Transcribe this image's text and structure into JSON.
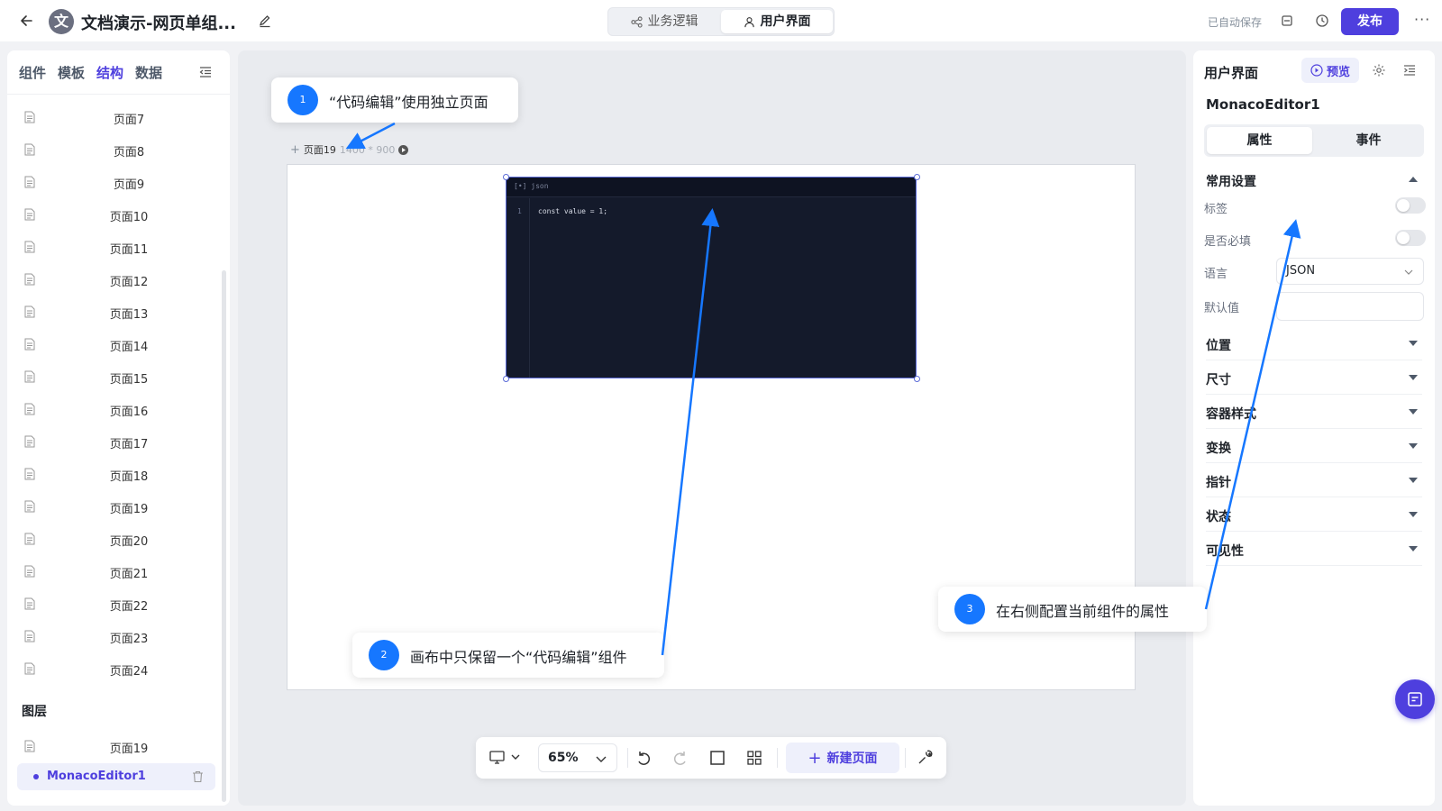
{
  "header": {
    "back_icon": "arrow-left-icon",
    "avatar_char": "文",
    "title": "文档演示-网页单组...",
    "mode_tabs": [
      {
        "label": "业务逻辑",
        "icon": "share-nodes-icon",
        "active": false
      },
      {
        "label": "用户界面",
        "icon": "user-icon",
        "active": true
      }
    ],
    "autosave": "已自动保存",
    "publish_label": "发布",
    "more_label": "···",
    "accent_color": "#4e3fde"
  },
  "left_panel": {
    "tabs": [
      {
        "label": "组件",
        "active": false
      },
      {
        "label": "模板",
        "active": false
      },
      {
        "label": "结构",
        "active": true
      },
      {
        "label": "数据",
        "active": false
      }
    ],
    "pages": [
      "页面7",
      "页面8",
      "页面9",
      "页面10",
      "页面11",
      "页面12",
      "页面13",
      "页面14",
      "页面15",
      "页面16",
      "页面17",
      "页面18",
      "页面19",
      "页面20",
      "页面21",
      "页面22",
      "页面23",
      "页面24"
    ],
    "layers_title": "图层",
    "layer_page": "页面19",
    "layer_item": "MonacoEditor1"
  },
  "canvas": {
    "page_name": "页面19",
    "page_dims": "1400 * 900",
    "editor": {
      "lang": "json",
      "line_number": "1",
      "code": "const value = 1;"
    }
  },
  "toolbar": {
    "zoom": "65%",
    "new_page_label": "新建页面"
  },
  "right_panel": {
    "title": "用户界面",
    "preview_label": "预览",
    "component_name": "MonacoEditor1",
    "seg_tabs": [
      "属性",
      "事件"
    ],
    "common_section": "常用设置",
    "fields": {
      "label": "标签",
      "required": "是否必填",
      "language": "语言",
      "language_value": "JSON",
      "default_value": "默认值"
    },
    "sections": [
      "位置",
      "尺寸",
      "容器样式",
      "变换",
      "指针",
      "状态",
      "可见性"
    ]
  },
  "callouts": [
    {
      "num": "1",
      "text": "“代码编辑”使用独立页面"
    },
    {
      "num": "2",
      "text": "画布中只保留一个“代码编辑”组件"
    },
    {
      "num": "3",
      "text": "在右侧配置当前组件的属性"
    }
  ]
}
